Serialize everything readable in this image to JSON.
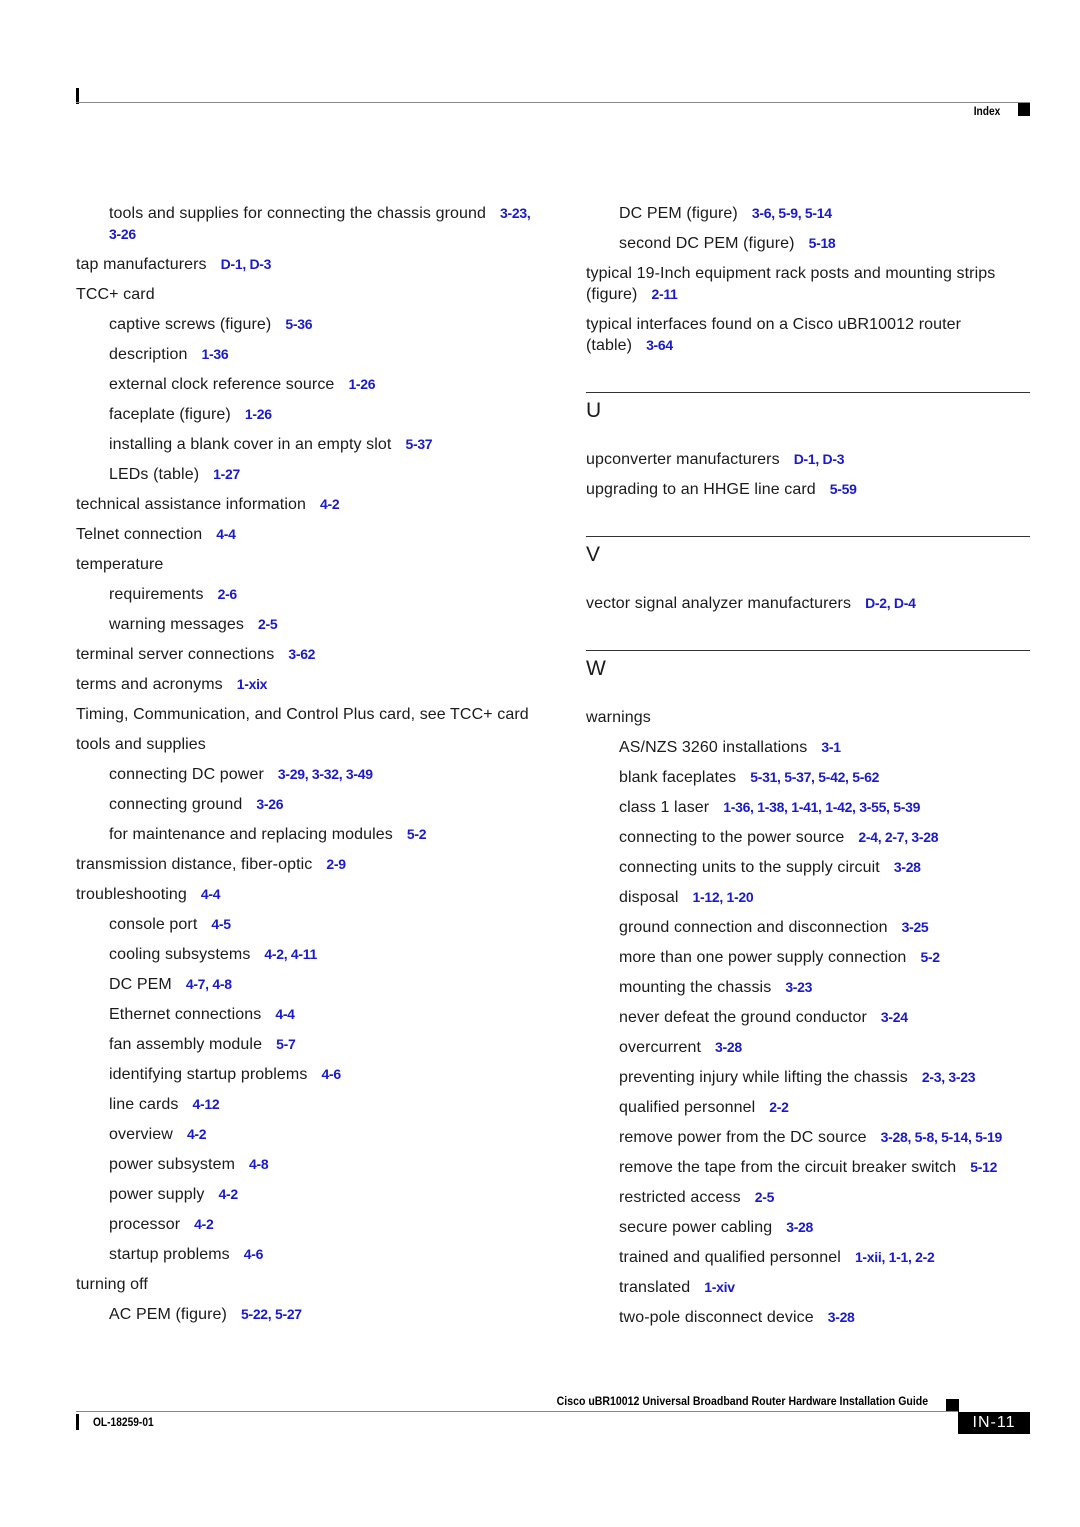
{
  "header": {
    "section_label": "Index"
  },
  "left_column": [
    {
      "level": 1,
      "text": "tools and supplies for connecting the chassis ground",
      "refs": "3-23, 3-26"
    },
    {
      "level": 0,
      "text": "tap manufacturers",
      "refs": "D-1, D-3"
    },
    {
      "level": 0,
      "text": "TCC+ card",
      "refs": ""
    },
    {
      "level": 1,
      "text": "captive screws (figure)",
      "refs": "5-36"
    },
    {
      "level": 1,
      "text": "description",
      "refs": "1-36"
    },
    {
      "level": 1,
      "text": "external clock reference source",
      "refs": "1-26"
    },
    {
      "level": 1,
      "text": "faceplate (figure)",
      "refs": "1-26"
    },
    {
      "level": 1,
      "text": "installing a blank cover in an empty slot",
      "refs": "5-37"
    },
    {
      "level": 1,
      "text": "LEDs (table)",
      "refs": "1-27"
    },
    {
      "level": 0,
      "text": "technical assistance information",
      "refs": "4-2"
    },
    {
      "level": 0,
      "text": "Telnet connection",
      "refs": "4-4"
    },
    {
      "level": 0,
      "text": "temperature",
      "refs": ""
    },
    {
      "level": 1,
      "text": "requirements",
      "refs": "2-6"
    },
    {
      "level": 1,
      "text": "warning messages",
      "refs": "2-5"
    },
    {
      "level": 0,
      "text": "terminal server connections",
      "refs": "3-62"
    },
    {
      "level": 0,
      "text": "terms and acronyms",
      "refs": "1-xix"
    },
    {
      "level": 0,
      "text": "Timing, Communication, and Control Plus card, see TCC+ card",
      "refs": ""
    },
    {
      "level": 0,
      "text": "tools and supplies",
      "refs": ""
    },
    {
      "level": 1,
      "text": "connecting DC power",
      "refs": "3-29, 3-32, 3-49"
    },
    {
      "level": 1,
      "text": "connecting ground",
      "refs": "3-26"
    },
    {
      "level": 1,
      "text": "for maintenance and replacing modules",
      "refs": "5-2"
    },
    {
      "level": 0,
      "text": "transmission distance, fiber-optic",
      "refs": "2-9"
    },
    {
      "level": 0,
      "text": "troubleshooting",
      "refs": "4-4"
    },
    {
      "level": 1,
      "text": "console port",
      "refs": "4-5"
    },
    {
      "level": 1,
      "text": "cooling subsystems",
      "refs": "4-2, 4-11"
    },
    {
      "level": 1,
      "text": "DC PEM",
      "refs": "4-7, 4-8"
    },
    {
      "level": 1,
      "text": "Ethernet connections",
      "refs": "4-4"
    },
    {
      "level": 1,
      "text": "fan assembly module",
      "refs": "5-7"
    },
    {
      "level": 1,
      "text": "identifying startup problems",
      "refs": "4-6"
    },
    {
      "level": 1,
      "text": "line cards",
      "refs": "4-12"
    },
    {
      "level": 1,
      "text": "overview",
      "refs": "4-2"
    },
    {
      "level": 1,
      "text": "power subsystem",
      "refs": "4-8"
    },
    {
      "level": 1,
      "text": "power supply",
      "refs": "4-2"
    },
    {
      "level": 1,
      "text": "processor",
      "refs": "4-2"
    },
    {
      "level": 1,
      "text": "startup problems",
      "refs": "4-6"
    },
    {
      "level": 0,
      "text": "turning off",
      "refs": ""
    },
    {
      "level": 1,
      "text": "AC PEM (figure)",
      "refs": "5-22, 5-27"
    }
  ],
  "right_column": {
    "continued": [
      {
        "level": 1,
        "text": "DC PEM (figure)",
        "refs": "3-6, 5-9, 5-14"
      },
      {
        "level": 1,
        "text": "second DC PEM (figure)",
        "refs": "5-18"
      },
      {
        "level": 0,
        "text": "typical 19-Inch equipment rack posts and mounting strips (figure)",
        "refs": "2-11"
      },
      {
        "level": 0,
        "text": "typical interfaces found on a Cisco uBR10012 router (table)",
        "refs": "3-64"
      }
    ],
    "sections": [
      {
        "letter": "U",
        "entries": [
          {
            "level": 0,
            "text": "upconverter manufacturers",
            "refs": "D-1, D-3"
          },
          {
            "level": 0,
            "text": "upgrading to an HHGE line card",
            "refs": "5-59"
          }
        ]
      },
      {
        "letter": "V",
        "entries": [
          {
            "level": 0,
            "text": "vector signal analyzer manufacturers",
            "refs": "D-2, D-4"
          }
        ]
      },
      {
        "letter": "W",
        "entries": [
          {
            "level": 0,
            "text": "warnings",
            "refs": ""
          },
          {
            "level": 1,
            "text": "AS/NZS 3260 installations",
            "refs": "3-1"
          },
          {
            "level": 1,
            "text": "blank faceplates",
            "refs": "5-31, 5-37, 5-42, 5-62"
          },
          {
            "level": 1,
            "text": "class 1 laser",
            "refs": "1-36, 1-38, 1-41, 1-42, 3-55, 5-39"
          },
          {
            "level": 1,
            "text": "connecting to the power source",
            "refs": "2-4, 2-7, 3-28"
          },
          {
            "level": 1,
            "text": "connecting units to the supply circuit",
            "refs": "3-28"
          },
          {
            "level": 1,
            "text": "disposal",
            "refs": "1-12, 1-20"
          },
          {
            "level": 1,
            "text": "ground connection and disconnection",
            "refs": "3-25"
          },
          {
            "level": 1,
            "text": "more than one power supply connection",
            "refs": "5-2"
          },
          {
            "level": 1,
            "text": "mounting the chassis",
            "refs": "3-23"
          },
          {
            "level": 1,
            "text": "never defeat the ground conductor",
            "refs": "3-24"
          },
          {
            "level": 1,
            "text": "overcurrent",
            "refs": "3-28"
          },
          {
            "level": 1,
            "text": "preventing injury while lifting the chassis",
            "refs": "2-3, 3-23"
          },
          {
            "level": 1,
            "text": "qualified personnel",
            "refs": "2-2"
          },
          {
            "level": 1,
            "text": "remove power from the DC source",
            "refs": "3-28, 5-8, 5-14, 5-19"
          },
          {
            "level": 1,
            "text": "remove the tape from the circuit breaker switch",
            "refs": "5-12"
          },
          {
            "level": 1,
            "text": "restricted access",
            "refs": "2-5"
          },
          {
            "level": 1,
            "text": "secure power cabling",
            "refs": "3-28"
          },
          {
            "level": 1,
            "text": "trained and qualified personnel",
            "refs": "1-xii, 1-1, 2-2"
          },
          {
            "level": 1,
            "text": "translated",
            "refs": "1-xiv"
          },
          {
            "level": 1,
            "text": "two-pole disconnect device",
            "refs": "3-28"
          }
        ]
      }
    ]
  },
  "footer": {
    "guide_title": "Cisco uBR10012 Universal Broadband Router Hardware Installation Guide",
    "doc_number": "OL-18259-01",
    "page_number": "IN-11"
  },
  "colors": {
    "link": "#1a1acc",
    "text": "#1a1a1a",
    "rule": "#333333"
  }
}
